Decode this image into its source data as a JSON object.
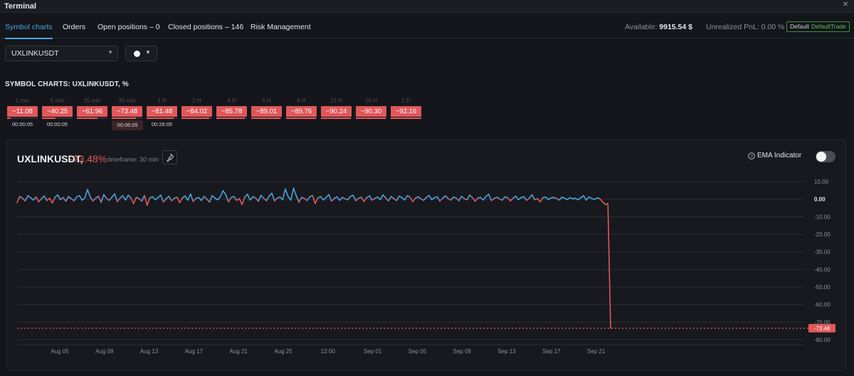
{
  "window": {
    "title": "Terminal"
  },
  "tabs": [
    {
      "label": "Symbol charts",
      "active": true
    },
    {
      "label": "Orders"
    },
    {
      "label": "Open positions – 0"
    },
    {
      "label": "Closed positions – 146"
    },
    {
      "label": "Risk Management"
    }
  ],
  "account": {
    "available_label": "Available:",
    "available_value": "9915.54 $",
    "pnl_label": "Unrealized PnL:",
    "pnl_value": "0.00 %",
    "badge_default": "Default",
    "badge_trade": "DefaultTrade"
  },
  "symbol_select": {
    "value": "UXLINKUSDT"
  },
  "section_title": "SYMBOL CHARTS: UXLINKUSDT,",
  "section_unit": "%",
  "timeframes": [
    {
      "label": "1 min",
      "value": "−11.08",
      "timer": "00:00:05",
      "bar": 0.12
    },
    {
      "label": "5 min",
      "value": "−40.25",
      "timer": "00:00:05",
      "bar": 0.44
    },
    {
      "label": "15 min",
      "value": "−61.96",
      "timer": "",
      "bar": 0.67
    },
    {
      "label": "30 min",
      "value": "−73.48",
      "timer": "00:06:05",
      "bar": 0.8,
      "active": true
    },
    {
      "label": "1 H",
      "value": "−81.48",
      "timer": "00:26:05",
      "bar": 0.88
    },
    {
      "label": "2 H",
      "value": "−84.02",
      "timer": "",
      "bar": 0.91
    },
    {
      "label": "4 H",
      "value": "−85.78",
      "timer": "",
      "bar": 0.93
    },
    {
      "label": "6 H",
      "value": "−89.01",
      "timer": "",
      "bar": 0.96
    },
    {
      "label": "8 H",
      "value": "−89.76",
      "timer": "",
      "bar": 0.97
    },
    {
      "label": "12 H",
      "value": "−90.24",
      "timer": "",
      "bar": 0.98
    },
    {
      "label": "16 H",
      "value": "−90.30",
      "timer": "",
      "bar": 0.98
    },
    {
      "label": "1 D",
      "value": "−92.16",
      "timer": "",
      "bar": 1.0
    }
  ],
  "chart_header": {
    "symbol": "UXLINKUSDT,",
    "change": "-73.48%",
    "timeframe": "timeframe: 30 min",
    "ema_label": "EMA Indicator"
  },
  "colors": {
    "accent": "#4aa3df",
    "negative": "#e0585a",
    "positive": "#4aa3df"
  },
  "chart_data": {
    "type": "line",
    "ylim": [
      -80,
      10
    ],
    "yticks": [
      "10.00",
      "0.00",
      "-10.00",
      "-20.00",
      "-30.00",
      "-40.00",
      "-50.00",
      "-60.00",
      "-70.00",
      "-80.00"
    ],
    "xticks": [
      "Aug 05",
      "Aug 09",
      "Aug 13",
      "Aug 17",
      "Aug 21",
      "Aug 25",
      "12:00",
      "Sep 01",
      "Sep 05",
      "Sep 09",
      "Sep 13",
      "Sep 17",
      "Sep 21"
    ],
    "current_value": -73.48,
    "current_label": "-73.48",
    "series": [
      {
        "values": [
          -2.0,
          1.5,
          0.5,
          -1.0,
          2.0,
          0.8,
          -0.5,
          1.2,
          -1.5,
          0.3,
          1.8,
          -0.8,
          0.6,
          -2.2,
          1.0,
          2.4,
          -0.3,
          0.9,
          -1.2,
          1.5,
          0.2,
          -0.9,
          1.3,
          2.0,
          -0.6,
          0.8,
          5.5,
          1.2,
          -1.0,
          0.5,
          1.7,
          -1.8,
          2.6,
          0.4,
          -0.7,
          1.1,
          3.0,
          -1.4,
          0.6,
          1.9,
          -0.5,
          2.2,
          0.7,
          -2.5,
          1.0,
          0.3,
          -1.1,
          2.1,
          -3.5,
          0.8,
          1.4,
          -0.4,
          0.9,
          2.3,
          -1.6,
          0.2,
          1.6,
          -0.9,
          0.5,
          1.2,
          -2.0,
          0.7,
          1.8,
          -0.6,
          2.9,
          -1.3,
          0.4,
          1.0,
          -0.8,
          1.5,
          0.1,
          -1.7,
          2.0,
          0.6,
          -0.4,
          1.3,
          4.8,
          2.5,
          -1.5,
          0.9,
          1.6,
          -0.7,
          0.3,
          -3.0,
          1.1,
          2.8,
          -0.5,
          1.4,
          0.8,
          -1.2,
          2.2,
          0.5,
          -0.9,
          1.7,
          3.4,
          -1.0,
          0.6,
          1.2,
          -0.3,
          5.8,
          1.5,
          -0.6,
          6.2,
          2.0,
          -1.8,
          1.0,
          0.4,
          -0.8,
          1.3,
          2.1,
          -2.4,
          0.7,
          1.5,
          -0.5,
          0.9,
          2.6,
          -1.1,
          0.3,
          1.4,
          -0.7,
          1.0,
          0.2,
          -0.4,
          1.6,
          2.2,
          -0.9,
          0.5,
          1.1,
          -1.3,
          0.8,
          1.9,
          -0.6,
          0.4,
          1.2,
          -0.2,
          2.4,
          0.7,
          -1.0,
          1.5,
          0.3,
          -0.8,
          1.7,
          0.9,
          -0.5,
          2.0,
          1.1,
          -1.4,
          0.6,
          1.3,
          0.2,
          -0.7,
          1.0,
          2.1,
          -0.3,
          0.8,
          1.4,
          -1.1,
          0.5,
          1.9,
          0.4,
          -0.6,
          1.2,
          0.7,
          -0.9,
          1.6,
          0.3,
          -0.4,
          2.3,
          0.9,
          -1.2,
          0.6,
          1.0,
          -0.5,
          1.5,
          2.8,
          -0.8,
          0.4,
          1.1,
          0.2,
          -0.6,
          1.3,
          0.8,
          -1.0,
          0.5,
          1.7,
          -0.3,
          0.9,
          1.4,
          -0.7,
          0.6,
          2.5,
          -0.4,
          0.3,
          -1.5,
          0.8,
          1.2,
          -0.2,
          0.7,
          1.0,
          0.4,
          -0.5,
          1.1,
          0.6,
          -0.3,
          0.9,
          0.2,
          0.5,
          -0.4,
          0.8,
          2.0,
          -0.6,
          1.3,
          0.4,
          -0.2,
          0.7,
          0.3,
          -1.5,
          -3.0,
          -2.5,
          -73.48
        ]
      }
    ]
  }
}
